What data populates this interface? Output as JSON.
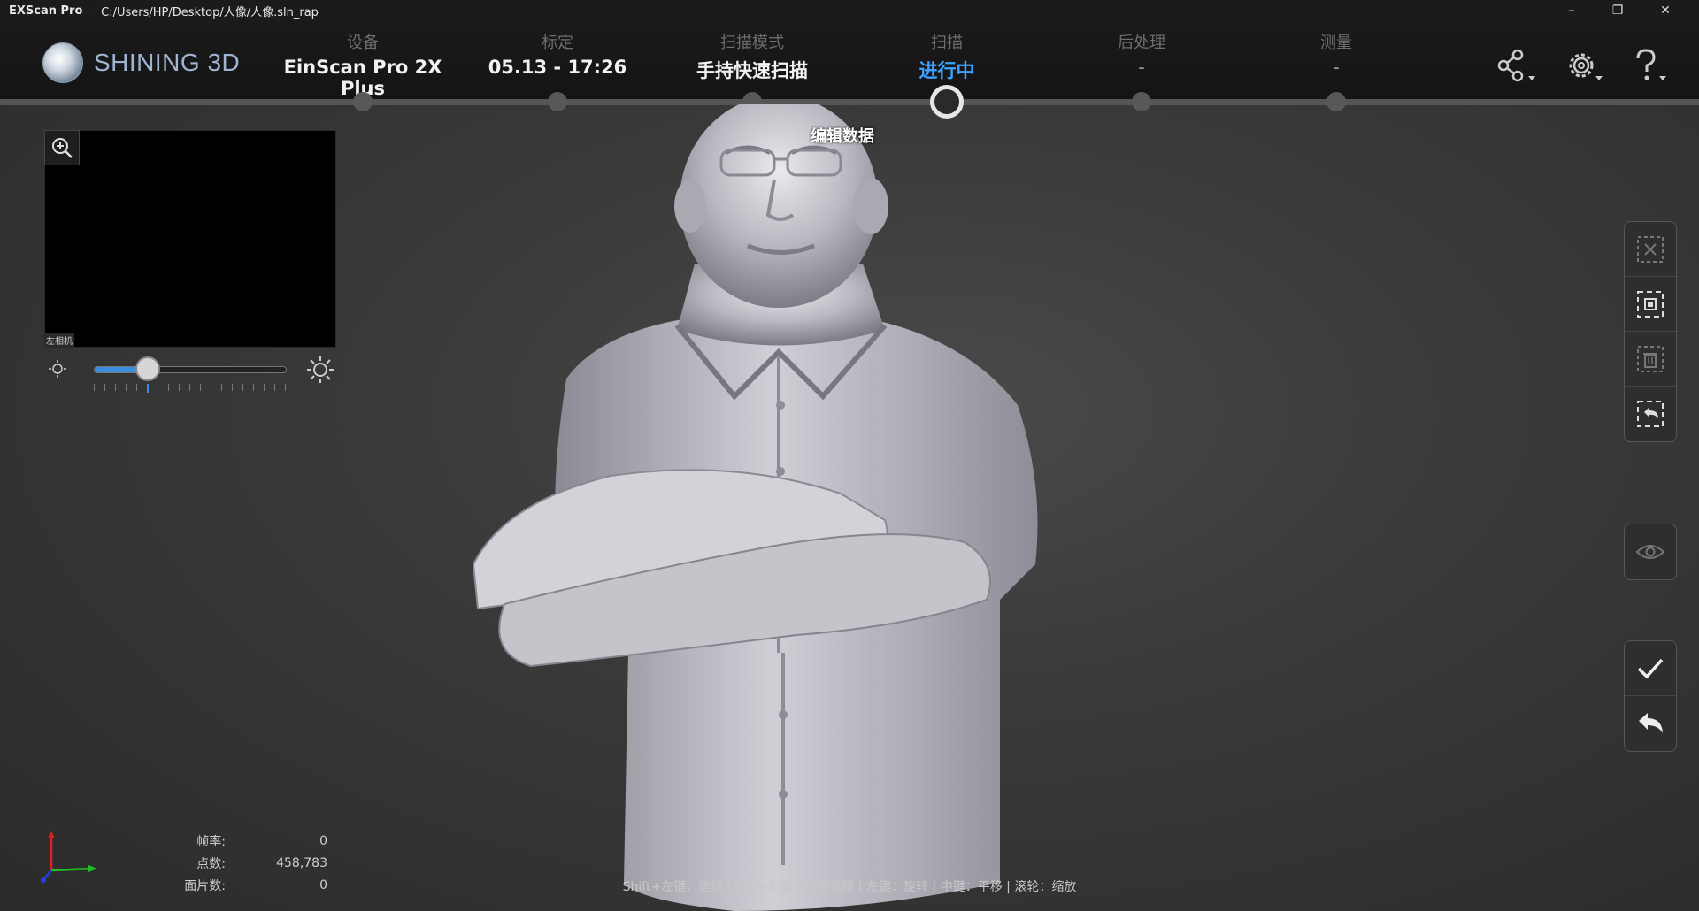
{
  "titlebar": {
    "app": "EXScan Pro",
    "separator": "-",
    "path": "C:/Users/HP/Desktop/人像/人像.sln_rap",
    "minimize": "–",
    "restore": "❐",
    "close": "✕"
  },
  "logo": {
    "text": "SHINING 3D"
  },
  "steps": [
    {
      "label": "设备",
      "value": "EinScan Pro 2X Plus"
    },
    {
      "label": "标定",
      "value": "05.13 - 17:26"
    },
    {
      "label": "扫描模式",
      "value": "手持快速扫描"
    },
    {
      "label": "扫描",
      "value": "进行中"
    },
    {
      "label": "后处理",
      "value": "-"
    },
    {
      "label": "测量",
      "value": "-"
    }
  ],
  "header_icons": [
    "share-icon",
    "gear-icon",
    "help-icon"
  ],
  "preview": {
    "camera_label": "左相机"
  },
  "brightness": {
    "level_fraction": 0.28
  },
  "canvas": {
    "edit_label": "编辑数据"
  },
  "stats": {
    "frame_rate_label": "帧率:",
    "frame_rate": "0",
    "points_label": "点数:",
    "points": "458,783",
    "faces_label": "面片数:",
    "faces": "0"
  },
  "hint": "Shift+左键：选择 | Ctrl+左键：取消选择 | 左键：旋转 | 中键：平移 | 滚轮：缩放",
  "colors": {
    "accent": "#3fa3ff",
    "background": "#3a3a3a"
  }
}
